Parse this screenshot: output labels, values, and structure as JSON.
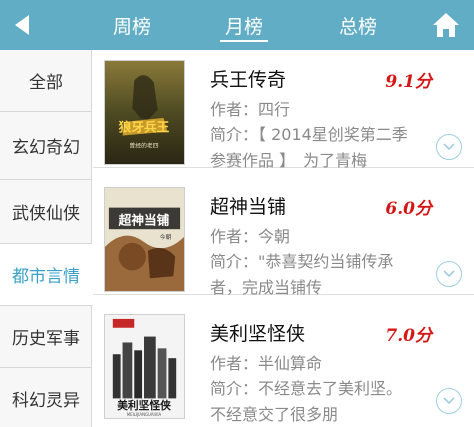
{
  "header": {
    "tabs": [
      {
        "label": "周榜",
        "active": false
      },
      {
        "label": "月榜",
        "active": true
      },
      {
        "label": "总榜",
        "active": false
      }
    ],
    "back_icon": "back-arrow-icon",
    "home_icon": "home-icon",
    "bg_color": "#62adc6"
  },
  "sidebar": {
    "items": [
      {
        "label": "全部"
      },
      {
        "label": "玄幻奇幻"
      },
      {
        "label": "武侠仙侠"
      },
      {
        "label": "都市言情",
        "active": true
      },
      {
        "label": "历史军事"
      },
      {
        "label": "科幻灵异"
      }
    ],
    "active_color": "#3aa0c8"
  },
  "books": [
    {
      "title": "兵王传奇",
      "score": "9.1分",
      "author": "作者：四行",
      "intro": "简介：【 2014星创奖第二季参赛作品 】　为了青梅",
      "cover_text": "狼牙兵王",
      "cover_sub": "曾经的老四"
    },
    {
      "title": "超神当铺",
      "score": "6.0分",
      "author": "作者：今朝",
      "intro": "简介：\"恭喜契约当铺传承者，完成当铺传",
      "cover_text": "超神当铺",
      "cover_sub": "今朝"
    },
    {
      "title": "美利坚怪侠",
      "score": "7.0分",
      "author": "作者：半仙算命",
      "intro": "简介：不经意去了美利坚。　不经意交了很多朋",
      "cover_text": "美利坚怪侠",
      "cover_sub": "MEILIJIANGUAIXIA"
    }
  ],
  "score_color": "#d61616"
}
